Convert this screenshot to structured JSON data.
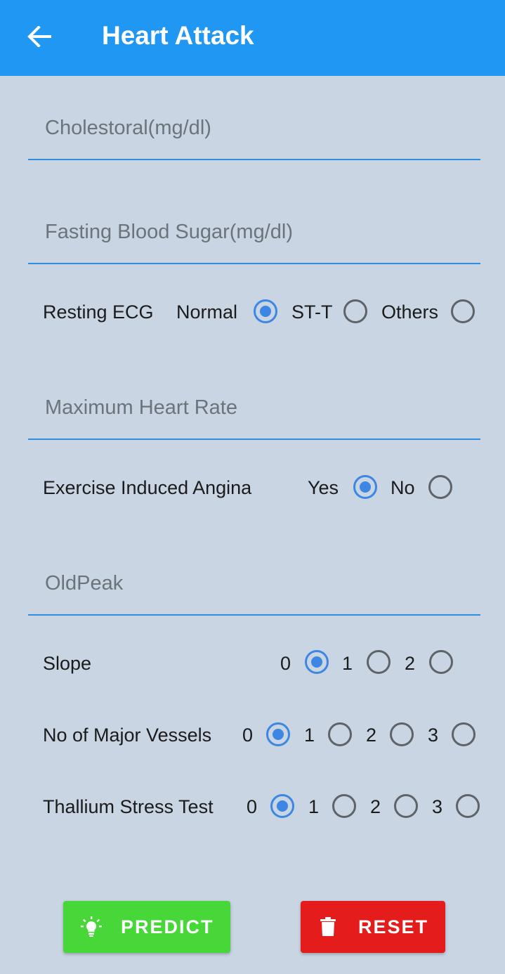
{
  "header": {
    "title": "Heart Attack",
    "back_icon": "arrow-back-icon",
    "color": "#2097f3"
  },
  "fields": {
    "cholesterol": {
      "placeholder": "Cholestoral(mg/dl)",
      "value": ""
    },
    "fasting_blood_sugar": {
      "placeholder": "Fasting Blood Sugar(mg/dl)",
      "value": ""
    },
    "max_heart_rate": {
      "placeholder": "Maximum Heart Rate",
      "value": ""
    },
    "oldpeak": {
      "placeholder": "OldPeak",
      "value": ""
    }
  },
  "resting_ecg": {
    "label": "Resting ECG",
    "options": [
      "Normal",
      "ST-T",
      "Others"
    ],
    "selected": "Normal"
  },
  "exercise_angina": {
    "label": "Exercise Induced Angina",
    "options": [
      "Yes",
      "No"
    ],
    "selected": "Yes"
  },
  "slope": {
    "label": "Slope",
    "options": [
      "0",
      "1",
      "2"
    ],
    "selected": "0"
  },
  "major_vessels": {
    "label": "No of Major Vessels",
    "options": [
      "0",
      "1",
      "2",
      "3"
    ],
    "selected": "0"
  },
  "thallium": {
    "label": "Thallium Stress Test",
    "options": [
      "0",
      "1",
      "2",
      "3"
    ],
    "selected": "0"
  },
  "buttons": {
    "predict": {
      "label": "PREDICT",
      "icon": "lightbulb-icon",
      "color": "#47d738"
    },
    "reset": {
      "label": "RESET",
      "icon": "trash-icon",
      "color": "#e51c1c"
    }
  },
  "radio_accent": "#3d86e4"
}
